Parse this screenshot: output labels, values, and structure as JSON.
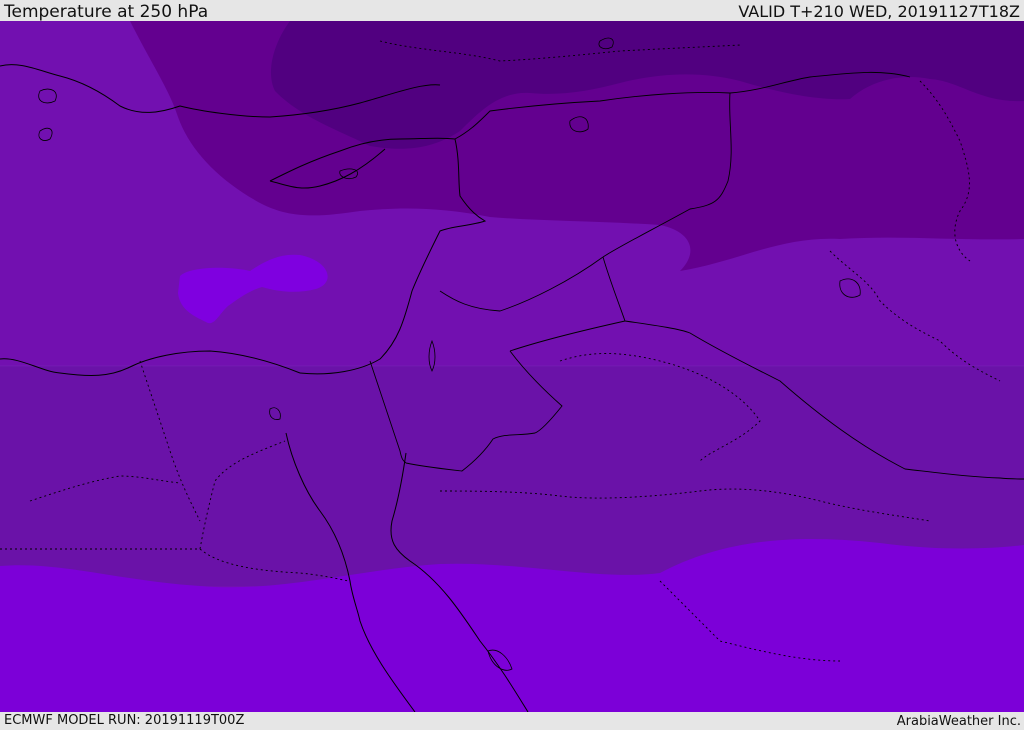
{
  "header": {
    "title": "Temperature at 250 hPa",
    "valid": "VALID T+210 WED, 20191127T18Z"
  },
  "footer": {
    "model_run": "ECMWF MODEL RUN: 20191119T00Z",
    "credit": "ArabiaWeather Inc."
  },
  "map": {
    "field": "temperature-250hPa",
    "colors": {
      "coldest": "#510080",
      "cold": "#63008f",
      "mid": "#7210b0",
      "mid_south": "#6a12a8",
      "warm": "#7c00d8",
      "warm_pocket": "#7f00e0",
      "boundary_line": "#000000"
    }
  }
}
